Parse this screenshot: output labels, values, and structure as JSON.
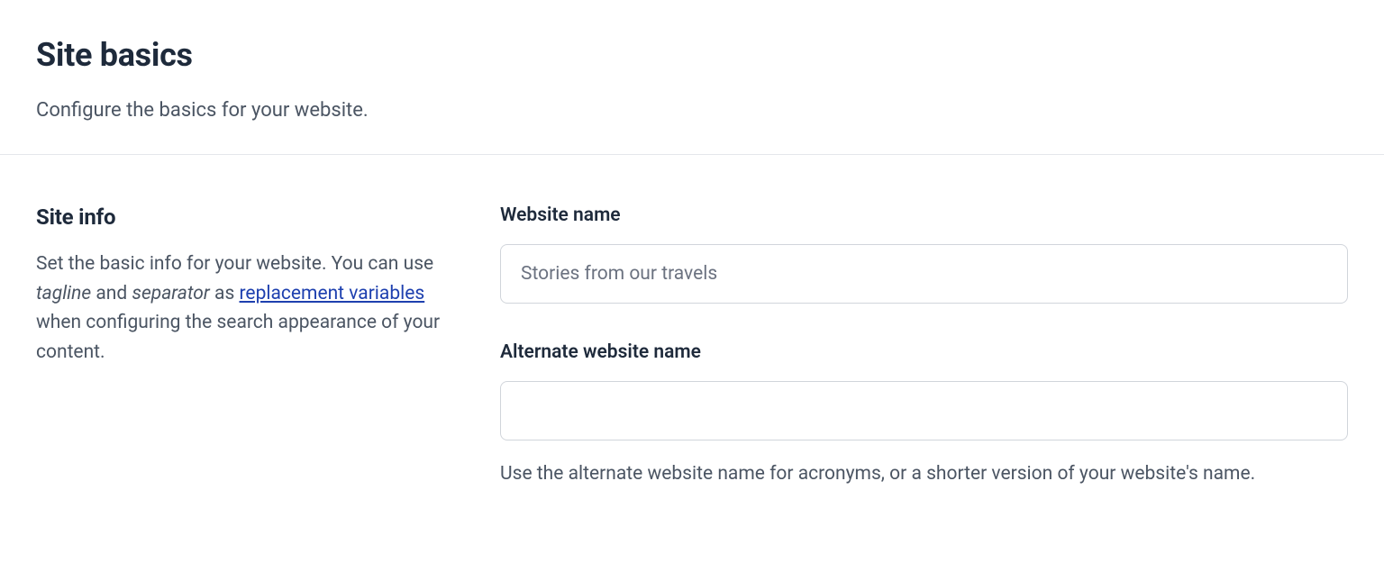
{
  "header": {
    "title": "Site basics",
    "subtitle": "Configure the basics for your website."
  },
  "site_info": {
    "heading": "Site info",
    "desc_pre": "Set the basic info for your website. You can use ",
    "tagline": "tagline",
    "and": " and ",
    "separator": "separator",
    "as": " as ",
    "link_text": "replacement variables",
    "desc_post": " when configuring the search appearance of your content."
  },
  "fields": {
    "website_name": {
      "label": "Website name",
      "value": "Stories from our travels"
    },
    "alternate_name": {
      "label": "Alternate website name",
      "value": "",
      "help": "Use the alternate website name for acronyms, or a shorter version of your website's name."
    }
  }
}
